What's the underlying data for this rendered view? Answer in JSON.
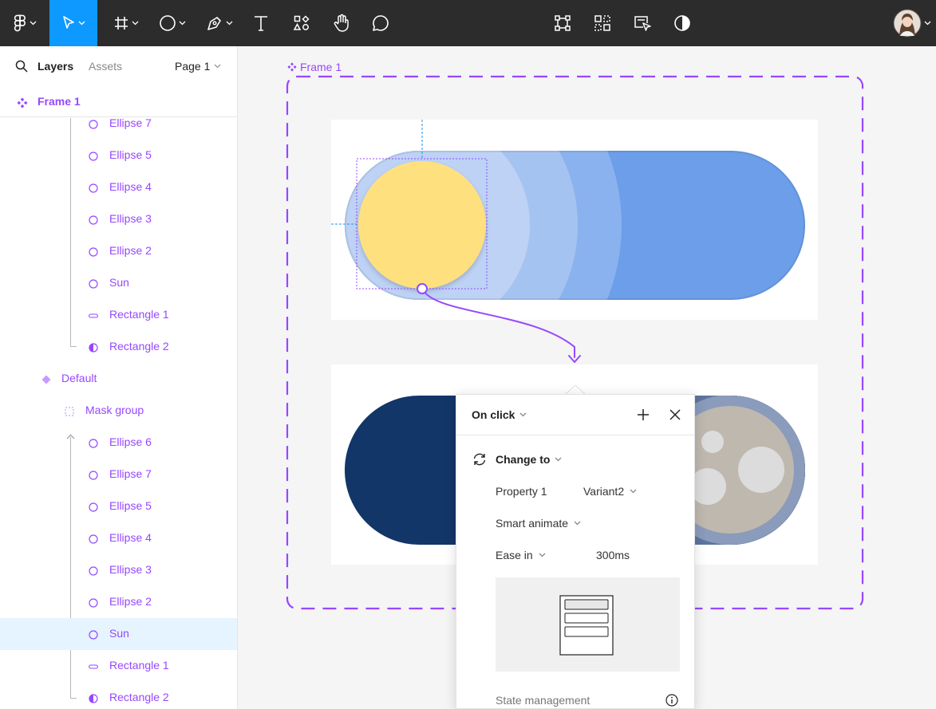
{
  "panel": {
    "tab_layers": "Layers",
    "tab_assets": "Assets",
    "page_selector": "Page 1",
    "frame_title": "Frame 1",
    "layers": [
      {
        "label": "Ellipse 7",
        "icon": "ellipse"
      },
      {
        "label": "Ellipse 5",
        "icon": "ellipse"
      },
      {
        "label": "Ellipse 4",
        "icon": "ellipse"
      },
      {
        "label": "Ellipse 3",
        "icon": "ellipse"
      },
      {
        "label": "Ellipse 2",
        "icon": "ellipse"
      },
      {
        "label": "Sun",
        "icon": "ellipse"
      },
      {
        "label": "Rectangle 1",
        "icon": "rectangle"
      },
      {
        "label": "Rectangle 2",
        "icon": "half-circle"
      },
      {
        "label": "Default",
        "icon": "component-variant"
      },
      {
        "label": "Mask group",
        "icon": "mask-group"
      },
      {
        "label": "Ellipse 6",
        "icon": "ellipse"
      },
      {
        "label": "Ellipse 7",
        "icon": "ellipse"
      },
      {
        "label": "Ellipse 5",
        "icon": "ellipse"
      },
      {
        "label": "Ellipse 4",
        "icon": "ellipse"
      },
      {
        "label": "Ellipse 3",
        "icon": "ellipse"
      },
      {
        "label": "Ellipse 2",
        "icon": "ellipse"
      },
      {
        "label": "Sun",
        "icon": "ellipse",
        "selected": true
      },
      {
        "label": "Rectangle 1",
        "icon": "rectangle"
      },
      {
        "label": "Rectangle 2",
        "icon": "half-circle"
      }
    ]
  },
  "canvas": {
    "frame_label": "Frame 1"
  },
  "interaction": {
    "trigger": "On click",
    "action": "Change to",
    "property_name": "Property 1",
    "property_value": "Variant2",
    "animation": "Smart animate",
    "easing": "Ease in",
    "duration": "300ms",
    "state_management": "State management"
  },
  "colors": {
    "accent": "#9747ff",
    "toolbar": "#2c2c2c",
    "active_tool": "#0d99ff",
    "sun": "#ffe07e",
    "day_track": "#6c9eea",
    "night_track": "#133669",
    "moon": "#bfb8ae"
  }
}
